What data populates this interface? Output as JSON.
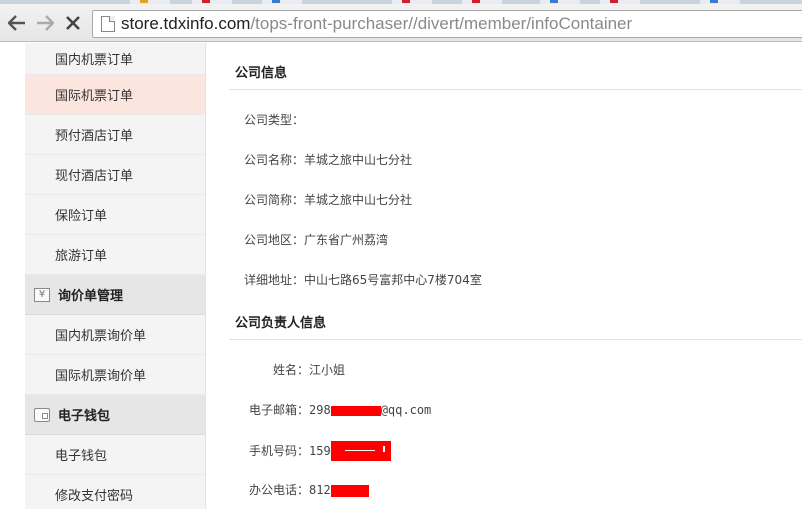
{
  "browser": {
    "url_host": "store.tdxinfo.com",
    "url_path": "/tops-front-purchaser//divert/member/infoContainer",
    "tab_marks": [
      "#e8a020",
      "#d02030",
      "#3a7ad0",
      "#d02030",
      "#d02030",
      "#3a7ad0",
      "#d02030",
      "#3a7ad0"
    ]
  },
  "sidebar": {
    "items_top": [
      {
        "label": "国内机票订单",
        "active": false
      },
      {
        "label": "国际机票订单",
        "active": true
      },
      {
        "label": "预付酒店订单",
        "active": false
      },
      {
        "label": "现付酒店订单",
        "active": false
      },
      {
        "label": "保险订单",
        "active": false
      },
      {
        "label": "旅游订单",
        "active": false
      }
    ],
    "group_inquiry": {
      "label": "询价单管理",
      "icon": "yen-icon",
      "icon_glyph": "¥"
    },
    "items_inquiry": [
      {
        "label": "国内机票询价单"
      },
      {
        "label": "国际机票询价单"
      }
    ],
    "group_wallet": {
      "label": "电子钱包",
      "icon": "wallet-icon"
    },
    "items_wallet": [
      {
        "label": "电子钱包"
      },
      {
        "label": "修改支付密码"
      }
    ]
  },
  "company": {
    "title": "公司信息",
    "type_label": "公司类型：",
    "type_value": "",
    "name_label": "公司名称：",
    "name_value": "羊城之旅中山七分社",
    "short_label": "公司简称：",
    "short_value": "羊城之旅中山七分社",
    "region_label": "公司地区：",
    "region_value": "广东省广州荔湾",
    "address_label": "详细地址：",
    "address_value": "中山七路65号富邦中心7楼704室"
  },
  "contact": {
    "title": "公司负责人信息",
    "name_label": "姓名：",
    "name_value": "江小姐",
    "email_label": "电子邮箱：",
    "email_prefix": "298",
    "email_suffix": "@qq.com",
    "mobile_label": "手机号码：",
    "mobile_prefix": "159",
    "phone_label": "办公电话：",
    "phone_prefix": "812"
  },
  "colors": {
    "active_item_bg": "#fde5df",
    "group_bg": "#e6e6e6",
    "redaction": "#ff0000"
  }
}
